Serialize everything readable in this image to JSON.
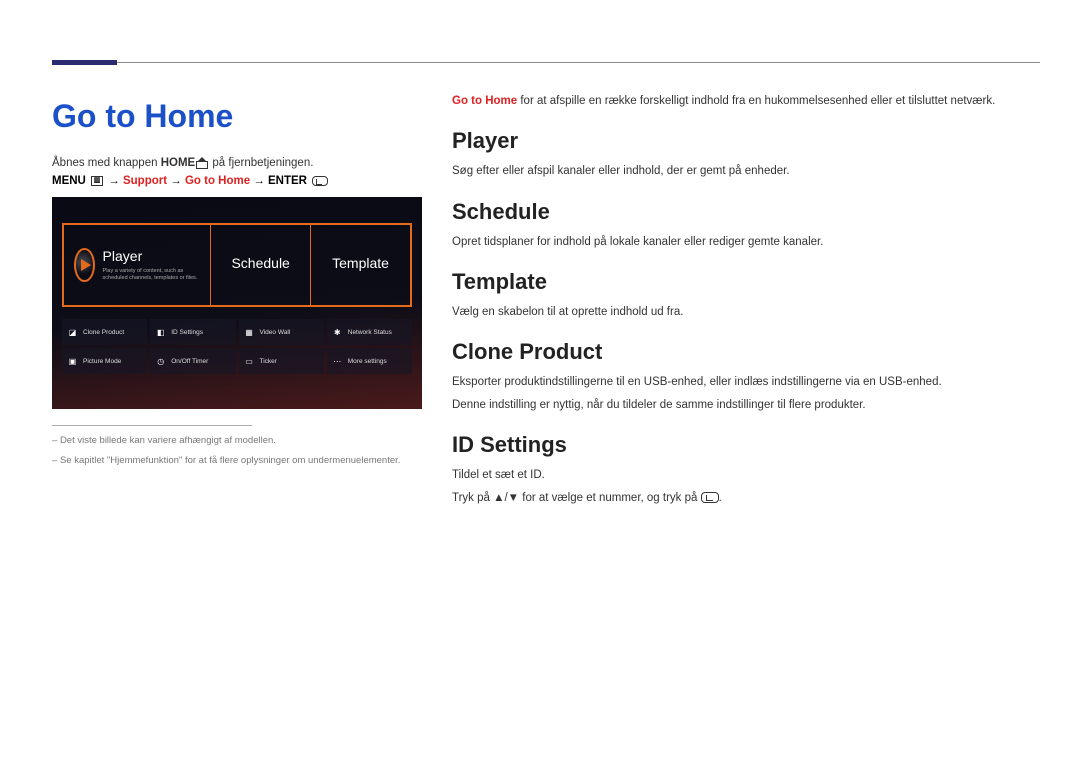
{
  "page": {
    "title": "Go to Home",
    "intro_prefix": "Åbnes med knappen ",
    "intro_bold": "HOME",
    "intro_suffix": " på fjernbetjeningen.",
    "menu_path": {
      "menu": "MENU",
      "support": "Support",
      "gotohome": "Go to Home",
      "enter": "ENTER",
      "arrow": " → "
    },
    "footnotes": [
      "Det viste billede kan variere afhængigt af modellen.",
      "Se kapitlet \"Hjemmefunktion\" for at få flere oplysninger om undermenuelementer."
    ]
  },
  "screenshot": {
    "tiles": {
      "player": {
        "label": "Player",
        "sub": "Play a variety of content, such as scheduled channels, templates or files."
      },
      "schedule": {
        "label": "Schedule"
      },
      "template": {
        "label": "Template"
      }
    },
    "grid": [
      {
        "label": "Clone Product",
        "color": "#5ab0ff"
      },
      {
        "label": "ID Settings",
        "color": "#ff5a9e"
      },
      {
        "label": "Video Wall",
        "color": "#6ad0ff"
      },
      {
        "label": "Network Status",
        "color": "#5ab0ff"
      },
      {
        "label": "Picture Mode",
        "color": "#8a5aff"
      },
      {
        "label": "On/Off Timer",
        "color": "#ff7a3a"
      },
      {
        "label": "Ticker",
        "color": "#5ab0ff"
      },
      {
        "label": "More settings",
        "color": "#8a9aff"
      }
    ]
  },
  "right": {
    "topnote_hl": "Go to Home",
    "topnote_rest": " for at afspille en række forskelligt indhold fra en hukommelsesenhed eller et tilsluttet netværk.",
    "sections": {
      "player": {
        "heading": "Player",
        "body": "Søg efter eller afspil kanaler eller indhold, der er gemt på enheder."
      },
      "schedule": {
        "heading": "Schedule",
        "body": "Opret tidsplaner for indhold på lokale kanaler eller rediger gemte kanaler."
      },
      "template": {
        "heading": "Template",
        "body": "Vælg en skabelon til at oprette indhold ud fra."
      },
      "clone": {
        "heading": "Clone Product",
        "body1": "Eksporter produktindstillingerne til en USB-enhed, eller indlæs indstillingerne via en USB-enhed.",
        "body2": "Denne indstilling er nyttig, når du tildeler de samme indstillinger til flere produkter."
      },
      "id": {
        "heading": "ID Settings",
        "body1": "Tildel et sæt et ID.",
        "body2a": "Tryk på ",
        "body2b": " for at vælge et nummer, og tryk på ",
        "body2c": "."
      }
    }
  }
}
